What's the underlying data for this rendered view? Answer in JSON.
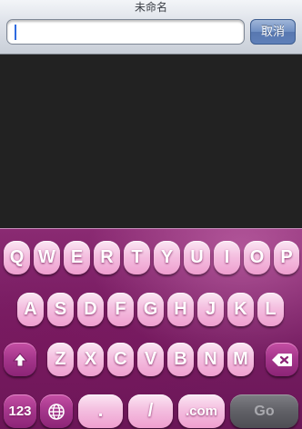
{
  "header": {
    "title": "未命名",
    "url_value": "",
    "cancel_label": "取消"
  },
  "keyboard": {
    "row1": [
      "Q",
      "W",
      "E",
      "R",
      "T",
      "Y",
      "U",
      "I",
      "O",
      "P"
    ],
    "row2": [
      "A",
      "S",
      "D",
      "F",
      "G",
      "H",
      "J",
      "K",
      "L"
    ],
    "row3": [
      "Z",
      "X",
      "C",
      "V",
      "B",
      "N",
      "M"
    ],
    "numbers_label": "123",
    "dot_label": ".",
    "slash_label": "/",
    "dotcom_label": ".com",
    "go_label": "Go",
    "icons": {
      "shift": "shift-icon",
      "delete": "backspace-icon",
      "globe": "globe-icon"
    }
  },
  "colors": {
    "key_face": "#f4bfe0",
    "keyboard_bg": "#7a1f65",
    "go_key": "#606066",
    "cancel_button": "#6f8fc3"
  }
}
